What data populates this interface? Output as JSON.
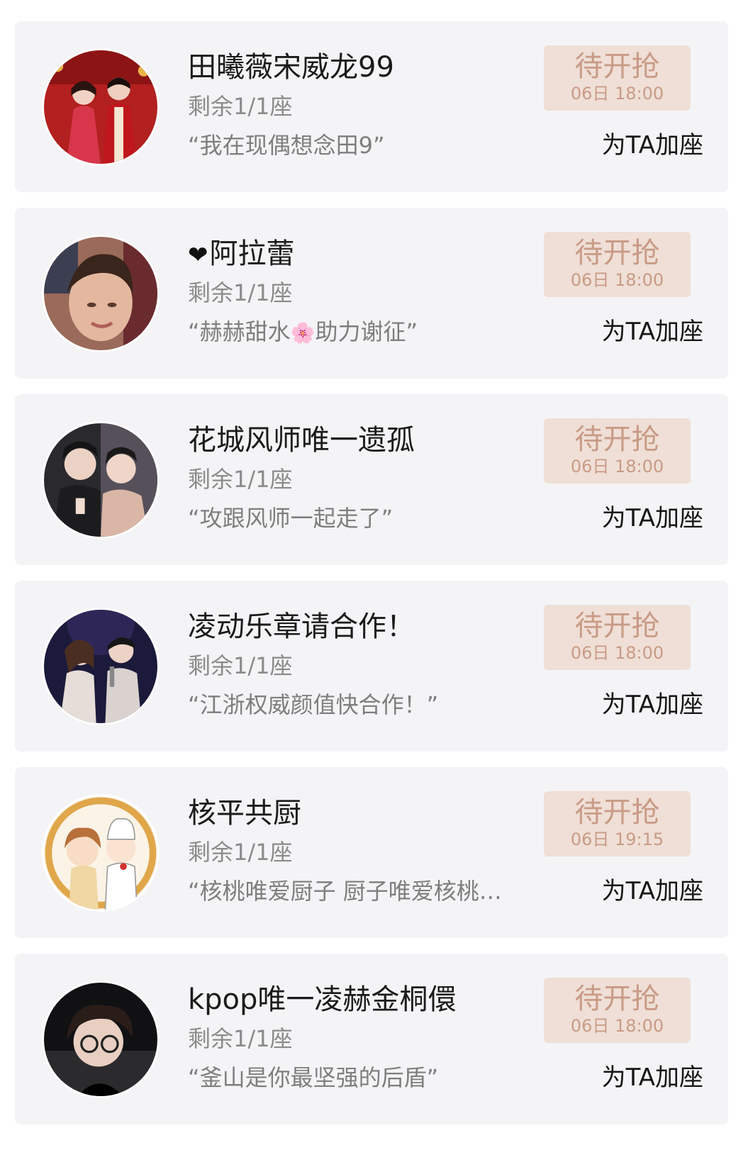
{
  "colors": {
    "card_background": "#f4f4f6",
    "button_background": "#efdfd6",
    "button_text": "#c99b86",
    "name_text": "#1b1b1b",
    "secondary_text": "#8b8b8b"
  },
  "cards": [
    {
      "name": "田曦薇宋威龙99",
      "seats": "剩余1/1座",
      "quote": "“我在现偶想念田9”",
      "button_label": "待开抢",
      "button_time": "06日 18:00",
      "action": "为TA加座"
    },
    {
      "name_prefix_icon": "heart-icon",
      "name": "阿拉蕾",
      "seats": "剩余1/1座",
      "quote_before": "“赫赫甜水",
      "quote_icon": "cherry-blossom-icon",
      "quote_after": "助力谢征”",
      "button_label": "待开抢",
      "button_time": "06日 18:00",
      "action": "为TA加座"
    },
    {
      "name": "花城风师唯一遗孤",
      "seats": "剩余1/1座",
      "quote": "“攻跟风师一起走了”",
      "button_label": "待开抢",
      "button_time": "06日 18:00",
      "action": "为TA加座"
    },
    {
      "name": "凌动乐章请合作！",
      "seats": "剩余1/1座",
      "quote": "“江浙权威颜值快合作！”",
      "button_label": "待开抢",
      "button_time": "06日 18:00",
      "action": "为TA加座"
    },
    {
      "name": "核平共厨",
      "seats": "剩余1/1座",
      "quote": "“核桃唯爱厨子 厨子唯爱核桃…",
      "button_label": "待开抢",
      "button_time": "06日 19:15",
      "action": "为TA加座"
    },
    {
      "name": "kpop唯一凌赫金桐儇",
      "seats": "剩余1/1座",
      "quote": "“釜山是你最坚强的后盾”",
      "button_label": "待开抢",
      "button_time": "06日 18:00",
      "action": "为TA加座"
    }
  ]
}
